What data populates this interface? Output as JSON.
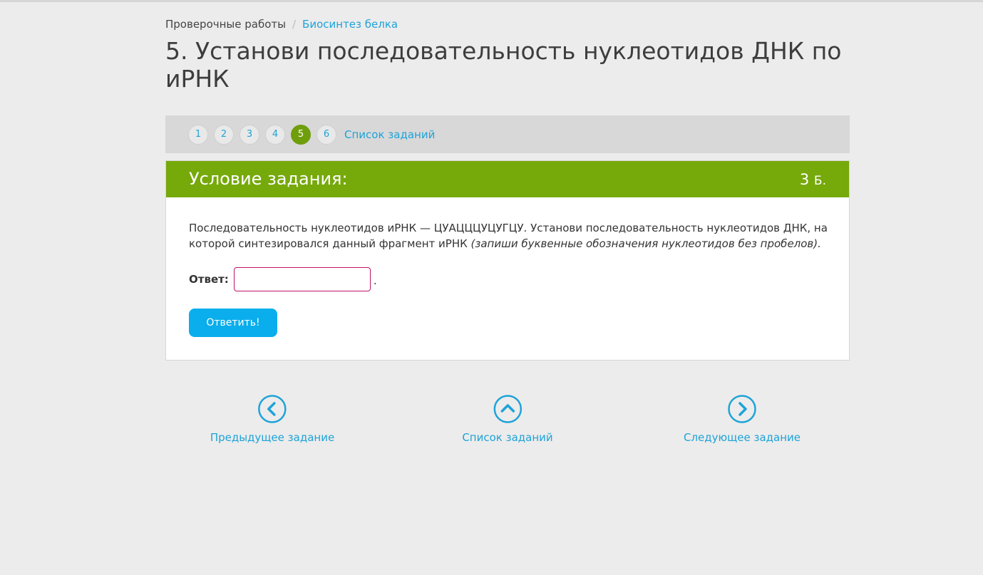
{
  "breadcrumb": {
    "root": "Проверочные работы",
    "separator": "/",
    "current": "Биосинтез белка"
  },
  "page_title": "5. Установи последовательность нуклеотидов ДНК по иРНК",
  "pager": {
    "pages": [
      "1",
      "2",
      "3",
      "4",
      "5",
      "6"
    ],
    "active_page": "5",
    "task_list_label": "Список заданий"
  },
  "task": {
    "header_title": "Условие задания:",
    "points_value": "3",
    "points_unit": "Б.",
    "text_main": "Последовательность нуклеотидов иРНК — ЦУАЦЦЦУЦУГЦУ. Установи последовательность нуклеотидов ДНК, на которой синтезировался данный фрагмент иРНК ",
    "text_hint": "(запиши буквенные обозначения нуклеотидов без пробелов).",
    "answer_label": "Ответ:",
    "answer_value": "",
    "answer_suffix": ".",
    "submit_label": "Ответить!"
  },
  "bottom_nav": {
    "prev_label": "Предыдущее задание",
    "list_label": "Список заданий",
    "next_label": "Следующее задание",
    "prev_icon": "chevron-left-circle-icon",
    "list_icon": "chevron-up-circle-icon",
    "next_icon": "chevron-right-circle-icon"
  },
  "colors": {
    "accent_green": "#76a90a",
    "link_blue": "#1ea3d8",
    "button_blue": "#0aaeec",
    "input_border": "#c0136a"
  }
}
